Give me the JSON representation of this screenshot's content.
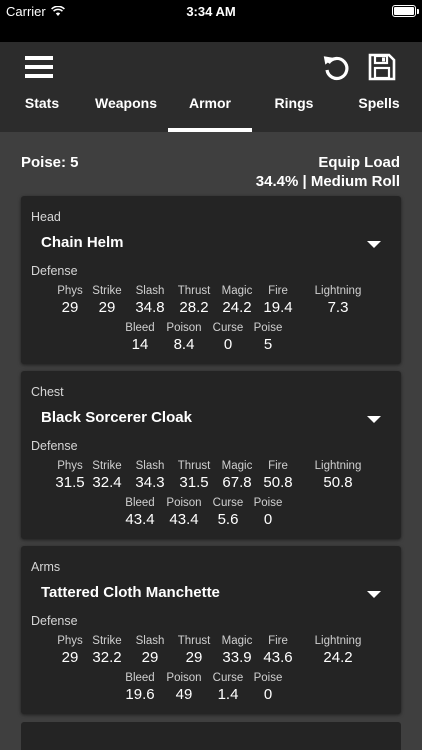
{
  "status_bar": {
    "carrier": "Carrier",
    "time": "3:34 AM"
  },
  "nav": {
    "tabs": [
      {
        "label": "Stats",
        "active": false
      },
      {
        "label": "Weapons",
        "active": false
      },
      {
        "label": "Armor",
        "active": true
      },
      {
        "label": "Rings",
        "active": false
      },
      {
        "label": "Spells",
        "active": false
      }
    ],
    "icons": {
      "menu": "hamburger-icon",
      "undo": "undo-icon",
      "save": "floppy-disk-icon"
    }
  },
  "summary": {
    "poise": "Poise: 5",
    "equip_load_label": "Equip Load",
    "equip_load_value": "34.4% | Medium Roll"
  },
  "stat_names": {
    "phys": "Phys",
    "strike": "Strike",
    "slash": "Slash",
    "thrust": "Thrust",
    "magic": "Magic",
    "fire": "Fire",
    "lightning": "Lightning",
    "bleed": "Bleed",
    "poison": "Poison",
    "curse": "Curse",
    "poise": "Poise"
  },
  "defense_label": "Defense",
  "armor": [
    {
      "slot": "Head",
      "name": "Chain Helm",
      "stats": {
        "phys": "29",
        "strike": "29",
        "slash": "34.8",
        "thrust": "28.2",
        "magic": "24.2",
        "fire": "19.4",
        "lightning": "7.3",
        "bleed": "14",
        "poison": "8.4",
        "curse": "0",
        "poise": "5"
      }
    },
    {
      "slot": "Chest",
      "name": "Black Sorcerer Cloak",
      "stats": {
        "phys": "31.5",
        "strike": "32.4",
        "slash": "34.3",
        "thrust": "31.5",
        "magic": "67.8",
        "fire": "50.8",
        "lightning": "50.8",
        "bleed": "43.4",
        "poison": "43.4",
        "curse": "5.6",
        "poise": "0"
      }
    },
    {
      "slot": "Arms",
      "name": "Tattered Cloth Manchette",
      "stats": {
        "phys": "29",
        "strike": "32.2",
        "slash": "29",
        "thrust": "29",
        "magic": "33.9",
        "fire": "43.6",
        "lightning": "24.2",
        "bleed": "19.6",
        "poison": "49",
        "curse": "1.4",
        "poise": "0"
      }
    }
  ]
}
